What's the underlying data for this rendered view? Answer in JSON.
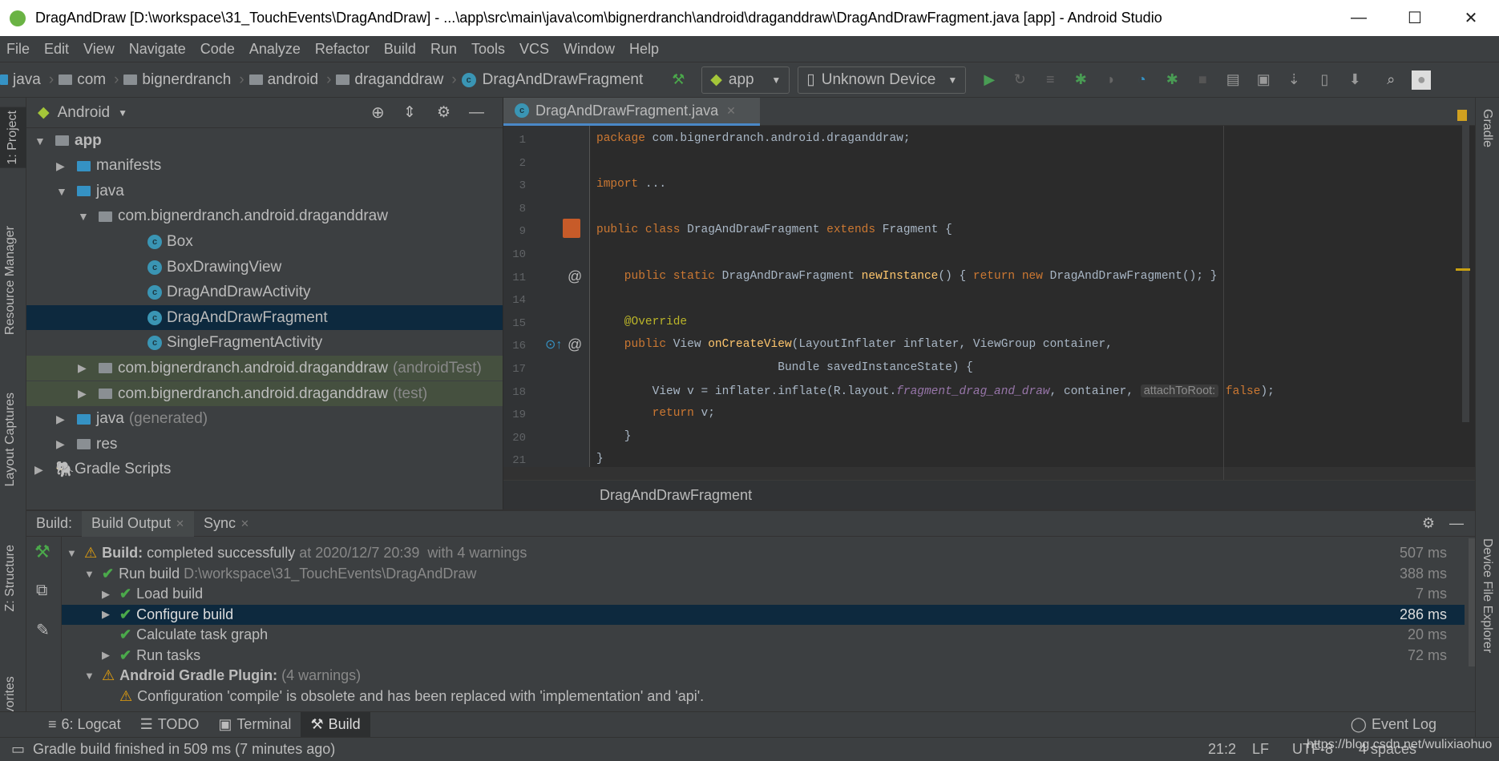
{
  "window": {
    "title": "DragAndDraw [D:\\workspace\\31_TouchEvents\\DragAndDraw] - ...\\app\\src\\main\\java\\com\\bignerdranch\\android\\draganddraw\\DragAndDrawFragment.java [app] - Android Studio",
    "minimize": "—",
    "maximize": "☐",
    "close": "✕"
  },
  "menu": [
    "File",
    "Edit",
    "View",
    "Navigate",
    "Code",
    "Analyze",
    "Refactor",
    "Build",
    "Run",
    "Tools",
    "VCS",
    "Window",
    "Help"
  ],
  "breadcrumbs": [
    "java",
    "com",
    "bignerdranch",
    "android",
    "draganddraw",
    "DragAndDrawFragment"
  ],
  "toolbar": {
    "config": "app",
    "device": "Unknown Device"
  },
  "left_stripe": [
    "1: Project",
    "Resource Manager",
    "Layout Captures",
    "Z: Structure",
    "Favorites"
  ],
  "right_stripe": [
    "Gradle",
    "Device File Explorer"
  ],
  "project": {
    "view": "Android",
    "tree": [
      {
        "label": "app",
        "extra": ""
      },
      {
        "label": "manifests",
        "extra": ""
      },
      {
        "label": "java",
        "extra": ""
      },
      {
        "label": "com.bignerdranch.android.draganddraw",
        "extra": ""
      },
      {
        "label": "Box",
        "extra": ""
      },
      {
        "label": "BoxDrawingView",
        "extra": ""
      },
      {
        "label": "DragAndDrawActivity",
        "extra": ""
      },
      {
        "label": "DragAndDrawFragment",
        "extra": ""
      },
      {
        "label": "SingleFragmentActivity",
        "extra": ""
      },
      {
        "label": "com.bignerdranch.android.draganddraw",
        "extra": "(androidTest)"
      },
      {
        "label": "com.bignerdranch.android.draganddraw",
        "extra": "(test)"
      },
      {
        "label": "java",
        "extra": "(generated)"
      },
      {
        "label": "res",
        "extra": ""
      },
      {
        "label": "Gradle Scripts",
        "extra": ""
      }
    ]
  },
  "editor": {
    "tab": "DragAndDrawFragment.java",
    "line_numbers": [
      "1",
      "2",
      "3",
      "8",
      "9",
      "10",
      "11",
      "14",
      "15",
      "16",
      "17",
      "18",
      "19",
      "20",
      "21"
    ],
    "code": {
      "l1a": "package",
      "l1b": " com.bignerdranch.android.draganddraw;",
      "l3a": "import",
      "l3b": " ...",
      "l9a": "public class",
      "l9b": " DragAndDrawFragment ",
      "l9c": "extends",
      "l9d": " Fragment {",
      "l11a": "    public static",
      "l11b": " DragAndDrawFragment ",
      "l11c": "newInstance",
      "l11d": "() { ",
      "l11e": "return new",
      "l11f": " DragAndDrawFragment(); }",
      "l15": "    @Override",
      "l16a": "    public",
      "l16b": " View ",
      "l16c": "onCreateView",
      "l16d": "(LayoutInflater inflater, ViewGroup container,",
      "l17": "                          Bundle savedInstanceState) {",
      "l18a": "        View v = inflater.inflate(R.layout.",
      "l18b": "fragment_drag_and_draw",
      "l18c": ", container, ",
      "l18d": "attachToRoot:",
      "l18e": " false",
      "l18f": ");",
      "l19a": "        return",
      "l19b": " v;",
      "l20": "    }",
      "l21": "}"
    },
    "breadcrumb": "DragAndDrawFragment"
  },
  "build": {
    "label": "Build:",
    "tabs": [
      "Build Output",
      "Sync"
    ],
    "rows": [
      {
        "bold": "Build:",
        "text": " completed successfully",
        "dim": " at 2020/12/7 20:39  with 4 warnings",
        "duration": "507 ms"
      },
      {
        "bold": "",
        "text": "Run build",
        "dim": " D:\\workspace\\31_TouchEvents\\DragAndDraw",
        "duration": "388 ms"
      },
      {
        "bold": "",
        "text": "Load build",
        "dim": "",
        "duration": "7 ms"
      },
      {
        "bold": "",
        "text": "Configure build",
        "dim": "",
        "duration": "286 ms"
      },
      {
        "bold": "",
        "text": "Calculate task graph",
        "dim": "",
        "duration": "20 ms"
      },
      {
        "bold": "",
        "text": "Run tasks",
        "dim": "",
        "duration": "72 ms"
      },
      {
        "bold": "Android Gradle Plugin:",
        "text": "",
        "dim": " (4 warnings)",
        "duration": ""
      },
      {
        "bold": "",
        "text": "Configuration 'compile' is obsolete and has been replaced with 'implementation' and 'api'.",
        "dim": "",
        "duration": ""
      }
    ]
  },
  "bottom_tabs": [
    "6: Logcat",
    "TODO",
    "Terminal",
    "Build"
  ],
  "event_log": "Event Log",
  "status": {
    "message": "Gradle build finished in 509 ms (7 minutes ago)",
    "position": "21:2",
    "line_sep": "LF",
    "encoding": "UTF-8",
    "indent": "4 spaces",
    "watermark": "https://blog.csdn.net/wulixiaohuo"
  },
  "colors": {
    "selection": "#0d293e",
    "keyword": "#cc7832",
    "method": "#ffc66d",
    "annotation": "#bbb529",
    "field": "#9876aa",
    "success": "#4ba94b",
    "warning": "#e5a00d"
  }
}
